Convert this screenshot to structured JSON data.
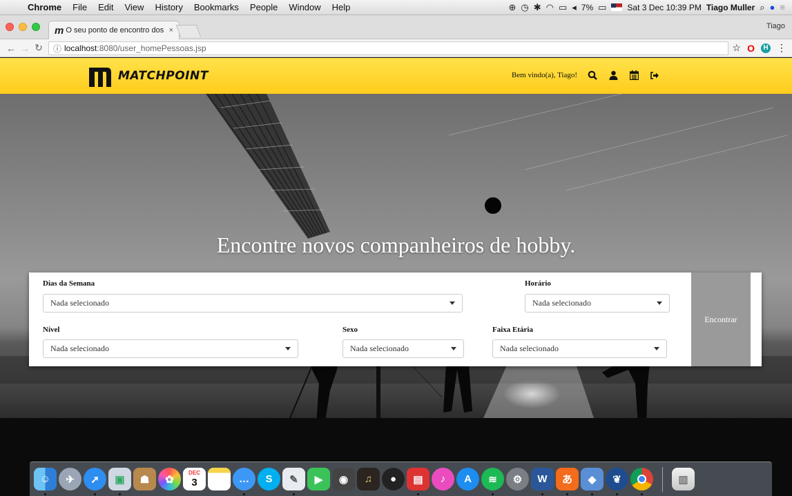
{
  "menubar": {
    "app": "Chrome",
    "items": [
      "File",
      "Edit",
      "View",
      "History",
      "Bookmarks",
      "People",
      "Window",
      "Help"
    ],
    "battery": "7%",
    "datetime": "Sat 3 Dec 10:39 PM",
    "user": "Tiago Muller"
  },
  "browser": {
    "tab_title": "O seu ponto de encontro dos",
    "profile_name": "Tiago",
    "url_prefix": "localhost",
    "url_rest": ":8080/user_homePessoas.jsp"
  },
  "header": {
    "brand": "MATCHPOINT",
    "welcome": "Bem vindo(a), Tiago!",
    "icons": [
      "search-icon",
      "user-icon",
      "calendar-icon",
      "sign-out-icon"
    ]
  },
  "hero": {
    "tagline": "Encontre novos companheiros de hobby."
  },
  "search": {
    "dias_label": "Dias da Semana",
    "dias_value": "Nada selecionado",
    "horario_label": "Horário",
    "horario_value": "Nada selecionado",
    "nivel_label": "Nível",
    "nivel_value": "Nada selecionado",
    "sexo_label": "Sexo",
    "sexo_value": "Nada selecionado",
    "faixa_label": "Faixa Etária",
    "faixa_value": "Nada selecionado",
    "button": "Encontrar"
  },
  "dock": {
    "calendar_day": "3",
    "calendar_month": "DEC"
  },
  "colors": {
    "header_yellow": "#ffd42a",
    "button_gray": "#9a9a9a"
  }
}
